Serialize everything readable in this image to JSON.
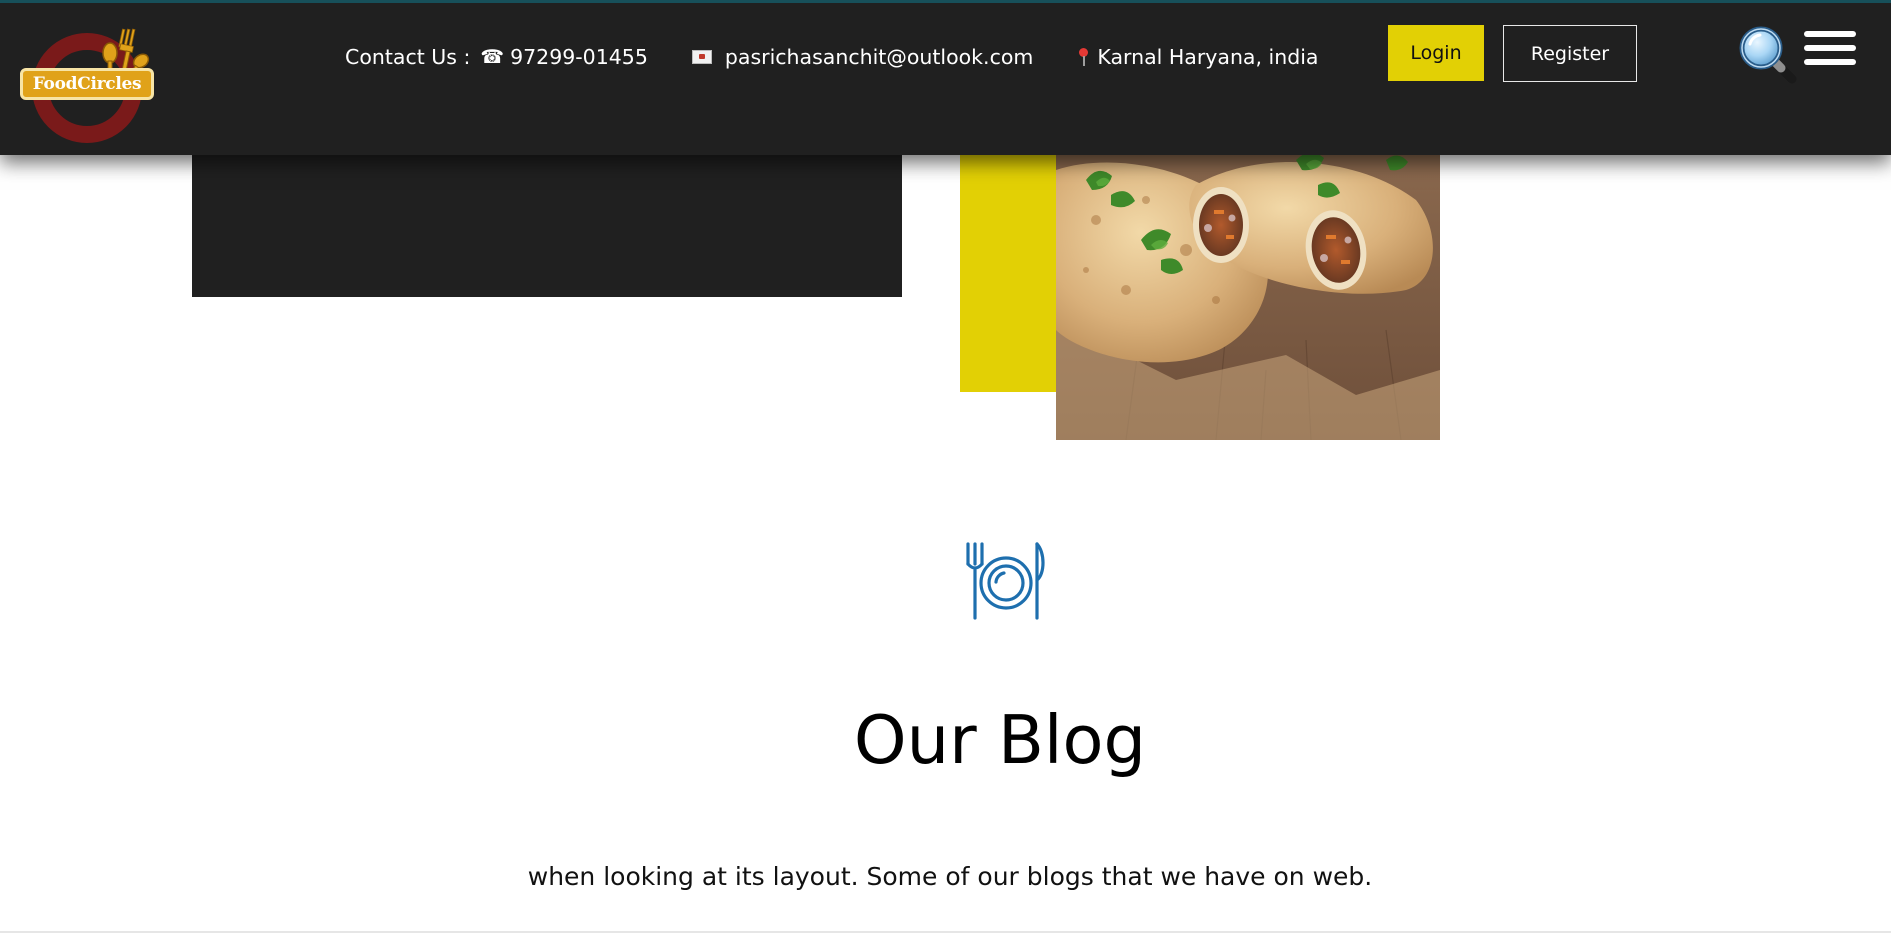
{
  "brand": {
    "logo_text": "FoodCircles"
  },
  "header": {
    "contact_label": "Contact Us :",
    "phone": "97299-01455",
    "email": "pasrichasanchit@outlook.com",
    "location": "Karnal Haryana, india",
    "login_label": "Login",
    "register_label": "Register",
    "icons": {
      "phone": "phone-icon",
      "email": "envelope-icon",
      "location": "map-pin-icon",
      "search": "magnifier-icon",
      "menu": "hamburger-icon"
    }
  },
  "blog": {
    "title": "Our Blog",
    "description": "when looking at its layout. Some of our blogs that we have on web.",
    "icon": "plate-cutlery-icon"
  },
  "colors": {
    "header_bg": "#202020",
    "accent_yellow": "#e2d005",
    "icon_blue": "#1e6fae",
    "logo_gold": "#e0a21a",
    "logo_ring": "#7a1a1a"
  }
}
